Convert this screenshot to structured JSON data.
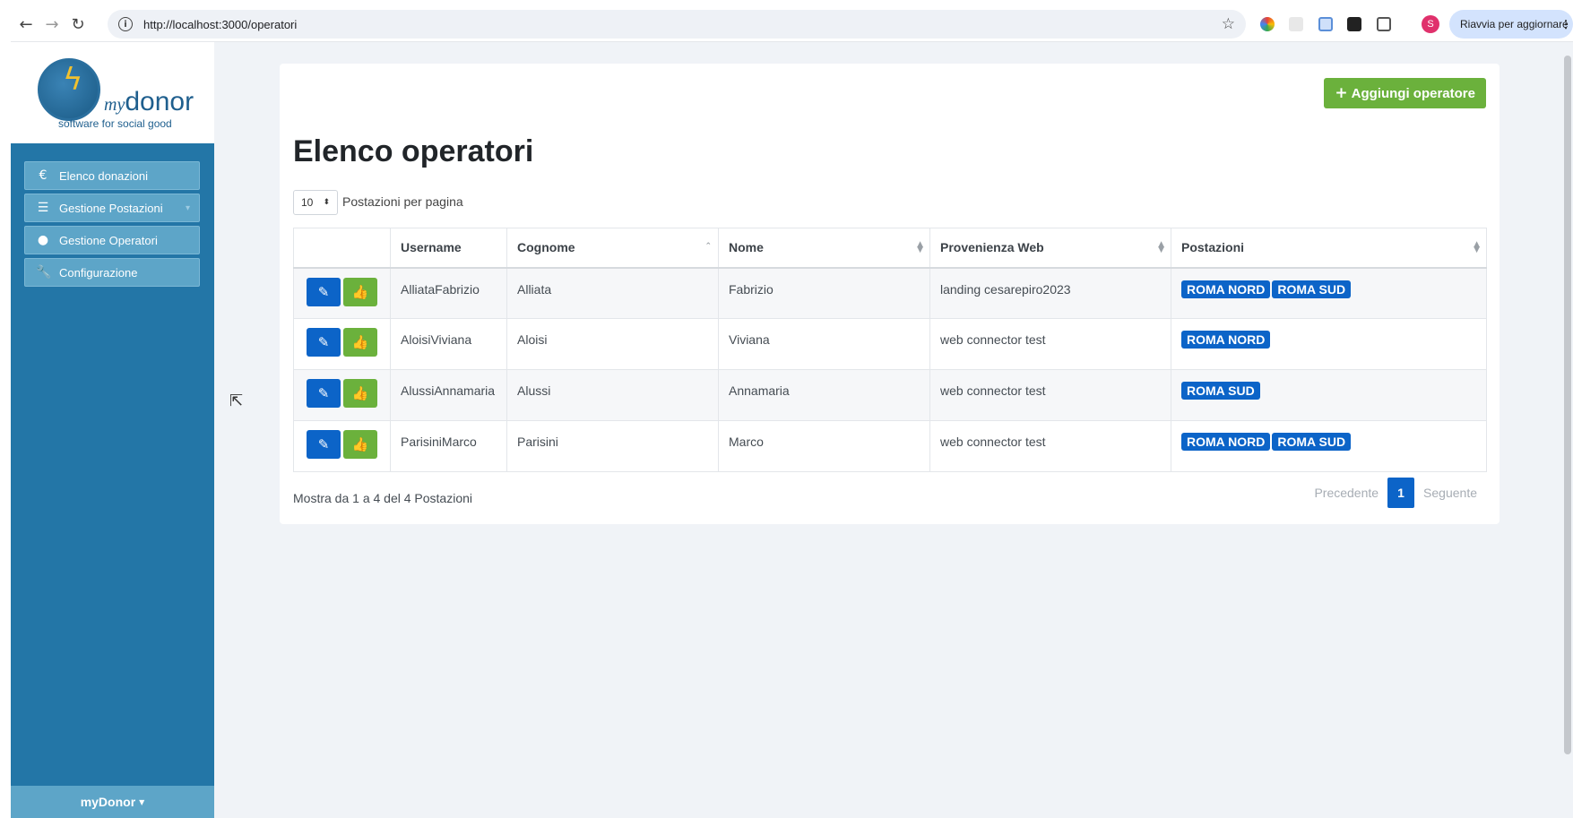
{
  "browser": {
    "url": "http://localhost:3000/operatori",
    "reload_pill": "Riavvia per aggiornare",
    "profile_initial": "S"
  },
  "sidebar": {
    "logo_my": "my",
    "logo_brand": "donor",
    "logo_tagline": "software for social good",
    "items": [
      {
        "label": "Elenco donazioni",
        "icon": "euro-icon"
      },
      {
        "label": "Gestione Postazioni",
        "icon": "list-icon"
      },
      {
        "label": "Gestione Operatori",
        "icon": "user-icon"
      },
      {
        "label": "Configurazione",
        "icon": "wrench-icon"
      }
    ],
    "footer": "myDonor"
  },
  "main": {
    "add_button": "Aggiungi operatore",
    "title": "Elenco operatori",
    "page_length": "10",
    "page_length_label": "Postazioni per pagina",
    "columns": [
      "Username",
      "Cognome",
      "Nome",
      "Provenienza Web",
      "Postazioni"
    ],
    "rows": [
      {
        "username": "AlliataFabrizio",
        "cognome": "Alliata",
        "nome": "Fabrizio",
        "provenienza": "landing cesarepiro2023",
        "postazioni": [
          "ROMA NORD",
          "ROMA SUD"
        ]
      },
      {
        "username": "AloisiViviana",
        "cognome": "Aloisi",
        "nome": "Viviana",
        "provenienza": "web connector test",
        "postazioni": [
          "ROMA NORD"
        ]
      },
      {
        "username": "AlussiAnnamaria",
        "cognome": "Alussi",
        "nome": "Annamaria",
        "provenienza": "web connector test",
        "postazioni": [
          "ROMA SUD"
        ]
      },
      {
        "username": "ParisiniMarco",
        "cognome": "Parisini",
        "nome": "Marco",
        "provenienza": "web connector test",
        "postazioni": [
          "ROMA NORD",
          "ROMA SUD"
        ]
      }
    ],
    "info": "Mostra da 1 a 4 del 4 Postazioni",
    "pager": {
      "prev": "Precedente",
      "current": "1",
      "next": "Seguente"
    }
  },
  "colors": {
    "sidebar": "#2376a7",
    "menu_item": "#5da5c8",
    "primary": "#0c64c8",
    "success": "#6bb13c",
    "background": "#f0f3f7"
  }
}
